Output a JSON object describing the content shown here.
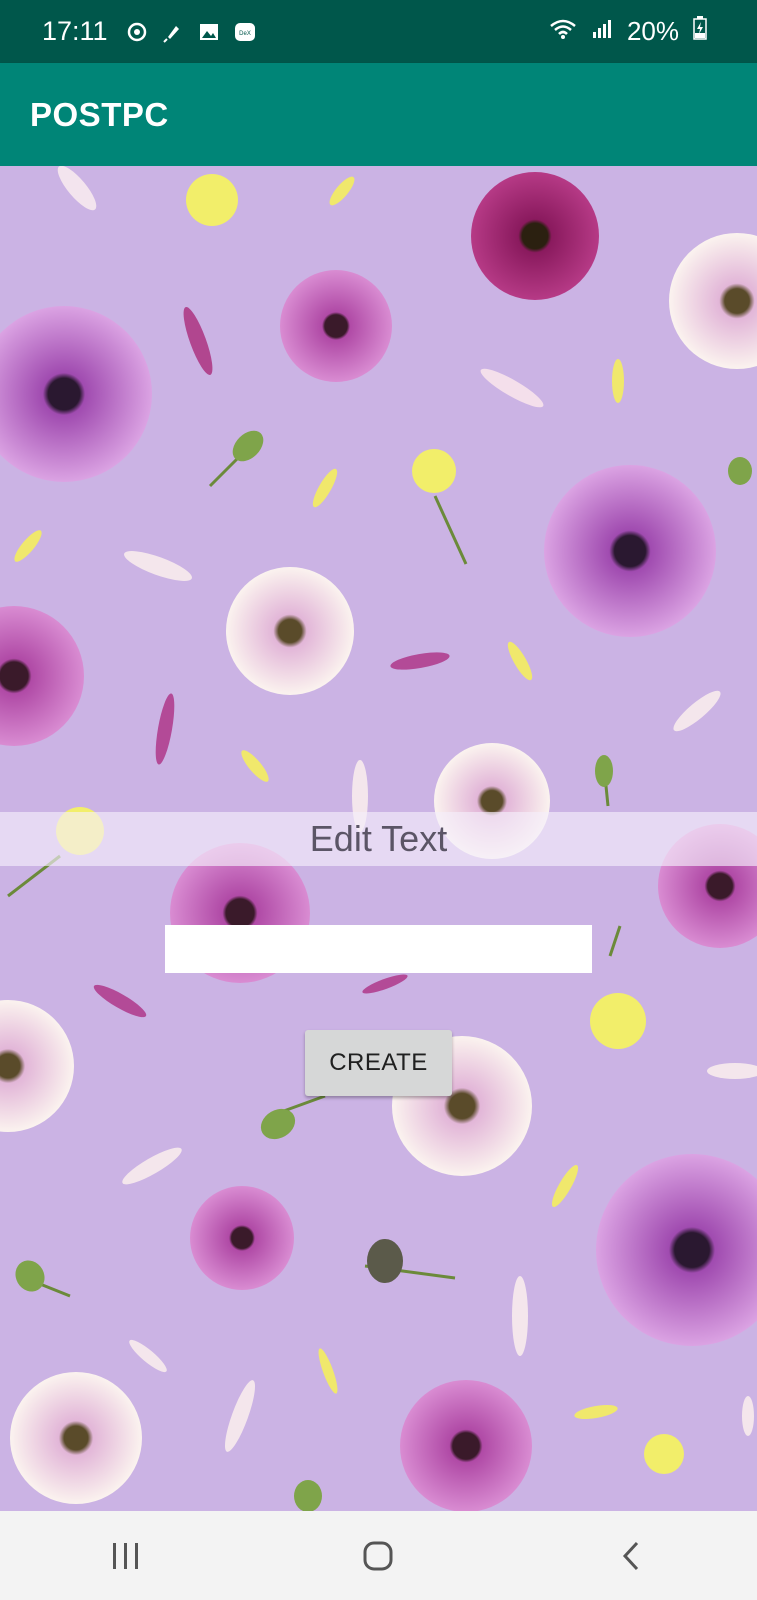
{
  "status_bar": {
    "time": "17:11",
    "battery": "20%",
    "icons": [
      "sync-icon",
      "microphone-icon",
      "image-icon",
      "dex-icon",
      "wifi-icon",
      "signal-icon",
      "battery-charging-icon"
    ]
  },
  "app_bar": {
    "title": "POSTPC"
  },
  "main": {
    "edit_banner_text": "Edit Text",
    "input_value": "",
    "create_button_label": "CREATE",
    "background": "purple floral photo with daisies and petals"
  },
  "nav_bar": {
    "buttons": [
      "recent-apps-icon",
      "home-icon",
      "back-icon"
    ]
  },
  "colors": {
    "status_bar": "#00574b",
    "app_bar": "#008577",
    "background": "#cbb3e4",
    "button": "#d6d7d7"
  }
}
